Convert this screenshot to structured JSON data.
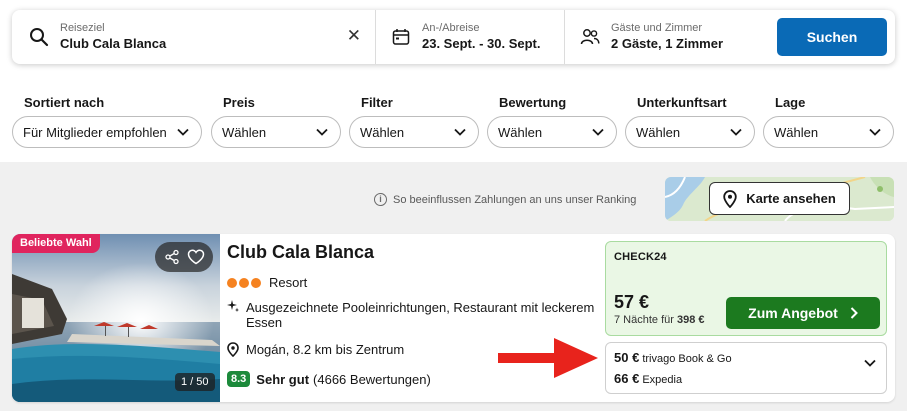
{
  "search": {
    "destination_label": "Reiseziel",
    "destination_value": "Club Cala Blanca",
    "clear_label": "✕",
    "dates_label": "An-/Abreise",
    "dates_value": "23. Sept. - 30. Sept.",
    "guests_label": "Gäste und Zimmer",
    "guests_value": "2 Gäste, 1 Zimmer",
    "button_label": "Suchen"
  },
  "filters": [
    {
      "title": "Sortiert nach",
      "value": "Für Mitglieder empfohlen"
    },
    {
      "title": "Preis",
      "value": "Wählen"
    },
    {
      "title": "Filter",
      "value": "Wählen"
    },
    {
      "title": "Bewertung",
      "value": "Wählen"
    },
    {
      "title": "Unterkunftsart",
      "value": "Wählen"
    },
    {
      "title": "Lage",
      "value": "Wählen"
    }
  ],
  "ranking_note": "So beeinflussen Zahlungen an uns unser Ranking",
  "map_button": "Karte ansehen",
  "hotel": {
    "badge": "Beliebte Wahl",
    "photo_counter": "1 / 50",
    "name": "Club Cala Blanca",
    "type": "Resort",
    "feature": "Ausgezeichnete Pooleinrichtungen, Restaurant mit leckerem Essen",
    "location": "Mogán, 8.2 km bis Zentrum",
    "rating_score": "8.3",
    "rating_label": "Sehr gut",
    "rating_count": "(4666 Bewertungen)"
  },
  "top_deal": {
    "provider": "CHECK24",
    "price": "57 €",
    "nights_text": "7 Nächte für",
    "nights_total": "398 €",
    "button_label": "Zum Angebot"
  },
  "other_deals": [
    {
      "price": "50 €",
      "provider": "trivago Book & Go"
    },
    {
      "price": "66 €",
      "provider": "Expedia"
    }
  ],
  "colors": {
    "search_button": "#0a6ab6",
    "deal_button": "#1c7a1f",
    "badge_popular": "#e0245e",
    "rating_badge": "#1c8a3b",
    "arrow": "#e8231c"
  }
}
